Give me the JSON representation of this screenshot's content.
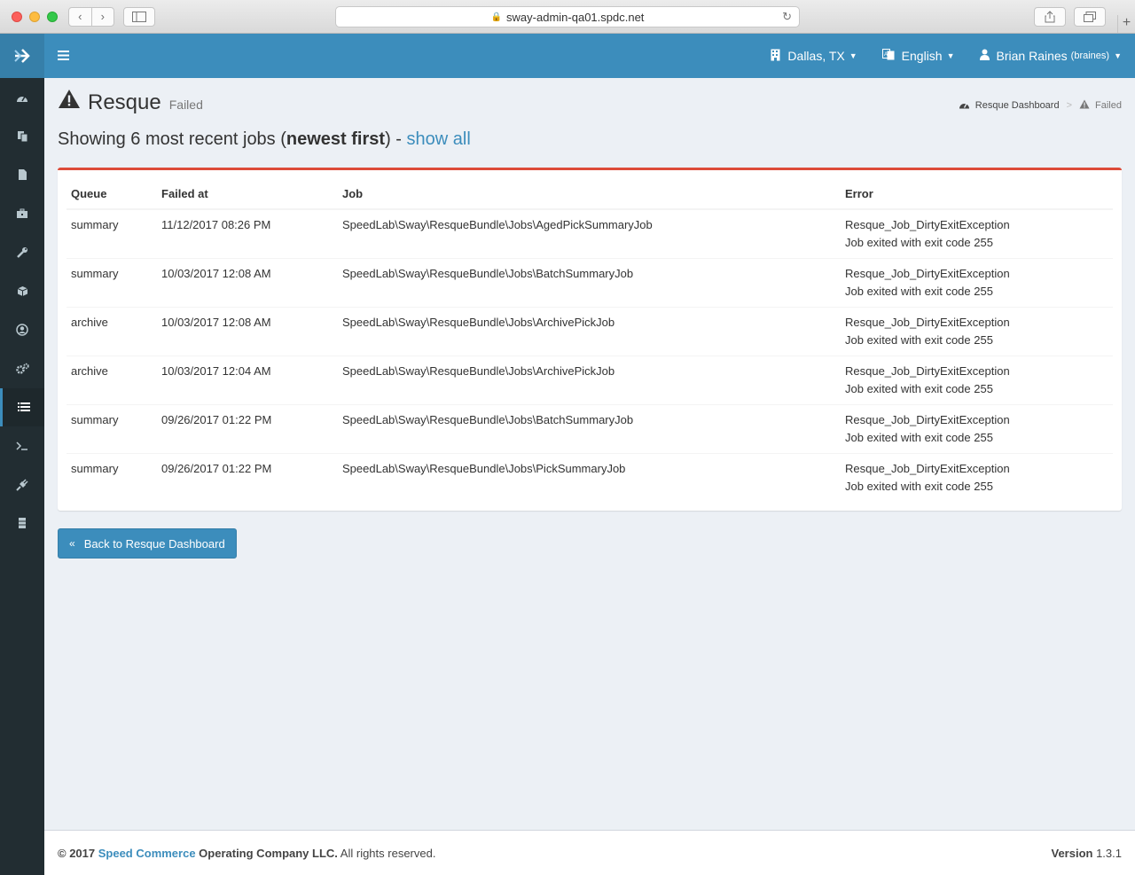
{
  "browser": {
    "url": "sway-admin-qa01.spdc.net",
    "back_icon": "chevron-left-icon",
    "forward_icon": "chevron-right-icon"
  },
  "sidebar": {
    "items": [
      {
        "icon": "dashboard-icon"
      },
      {
        "icon": "copy-icon"
      },
      {
        "icon": "file-icon"
      },
      {
        "icon": "briefcase-icon"
      },
      {
        "icon": "wrench-icon"
      },
      {
        "icon": "cube-icon"
      },
      {
        "icon": "user-circle-icon"
      },
      {
        "icon": "cogs-icon"
      },
      {
        "icon": "list-icon",
        "active": true
      },
      {
        "icon": "terminal-icon"
      },
      {
        "icon": "plug-icon"
      },
      {
        "icon": "server-icon"
      }
    ]
  },
  "navbar": {
    "location": "Dallas, TX",
    "language": "English",
    "user_name": "Brian Raines",
    "user_handle": "(braines)"
  },
  "page": {
    "title": "Resque",
    "subtitle": "Failed",
    "breadcrumb": {
      "home": "Resque Dashboard",
      "current": "Failed"
    },
    "heading_prefix": "Showing 6 most recent jobs (",
    "heading_bold": "newest first",
    "heading_suffix": ") - ",
    "heading_link": "show all"
  },
  "table": {
    "headers": {
      "queue": "Queue",
      "failed_at": "Failed at",
      "job": "Job",
      "error": "Error"
    },
    "rows": [
      {
        "queue": "summary",
        "failed_at": "11/12/2017 08:26 PM",
        "job": "SpeedLab\\Sway\\ResqueBundle\\Jobs\\AgedPickSummaryJob",
        "error": "Resque_Job_DirtyExitException",
        "message": "Job exited with exit code 255"
      },
      {
        "queue": "summary",
        "failed_at": "10/03/2017 12:08 AM",
        "job": "SpeedLab\\Sway\\ResqueBundle\\Jobs\\BatchSummaryJob",
        "error": "Resque_Job_DirtyExitException",
        "message": "Job exited with exit code 255"
      },
      {
        "queue": "archive",
        "failed_at": "10/03/2017 12:08 AM",
        "job": "SpeedLab\\Sway\\ResqueBundle\\Jobs\\ArchivePickJob",
        "error": "Resque_Job_DirtyExitException",
        "message": "Job exited with exit code 255"
      },
      {
        "queue": "archive",
        "failed_at": "10/03/2017 12:04 AM",
        "job": "SpeedLab\\Sway\\ResqueBundle\\Jobs\\ArchivePickJob",
        "error": "Resque_Job_DirtyExitException",
        "message": "Job exited with exit code 255"
      },
      {
        "queue": "summary",
        "failed_at": "09/26/2017 01:22 PM",
        "job": "SpeedLab\\Sway\\ResqueBundle\\Jobs\\BatchSummaryJob",
        "error": "Resque_Job_DirtyExitException",
        "message": "Job exited with exit code 255"
      },
      {
        "queue": "summary",
        "failed_at": "09/26/2017 01:22 PM",
        "job": "SpeedLab\\Sway\\ResqueBundle\\Jobs\\PickSummaryJob",
        "error": "Resque_Job_DirtyExitException",
        "message": "Job exited with exit code 255"
      }
    ]
  },
  "back_button": "Back to Resque Dashboard",
  "footer": {
    "copyright_prefix": "© 2017 ",
    "company_brand": "Speed Commerce",
    "company_rest": " Operating Company LLC.",
    "rights": " All rights reserved.",
    "version_label": "Version",
    "version_number": " 1.3.1"
  },
  "colors": {
    "brand_blue": "#3c8dbc",
    "sidebar_dark": "#222d32",
    "box_border_red": "#dd4b39"
  }
}
